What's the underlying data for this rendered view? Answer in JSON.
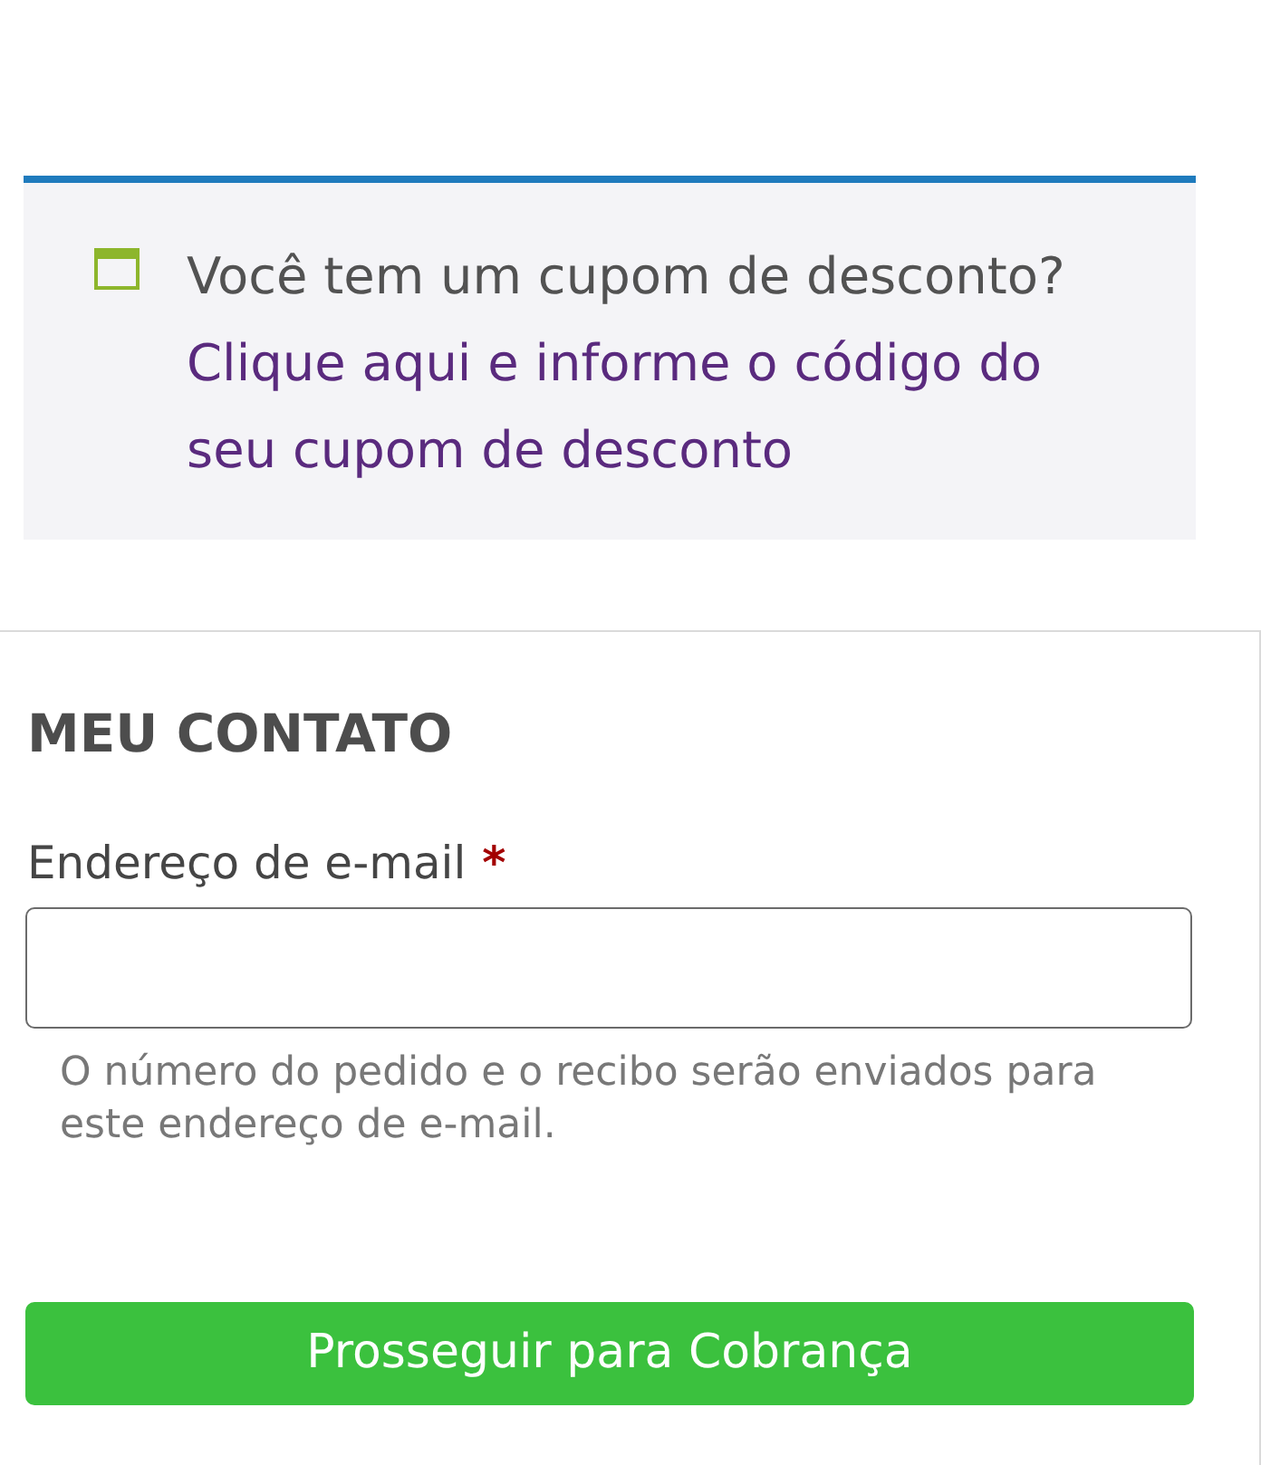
{
  "coupon_notice": {
    "question": "Você tem um cupom de desconto?",
    "link": "Clique aqui e informe o código do seu cupom de desconto"
  },
  "contact_section": {
    "title": "MEU CONTATO",
    "email_field": {
      "label": "Endereço de e-mail",
      "required_mark": "*"
    },
    "help_text": "O número do pedido e o recibo serão enviados para este endereço de e-mail."
  },
  "buttons": [
    {
      "label": "Prosseguir para Cobrança"
    }
  ]
}
